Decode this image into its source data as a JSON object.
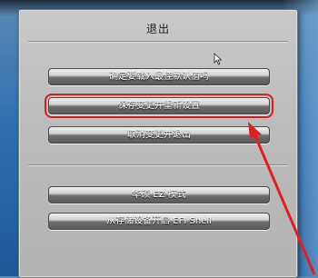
{
  "dialog": {
    "title": "退出",
    "buttons": [
      {
        "label": "确定要载入最佳默认值吗"
      },
      {
        "label": "保存变更并重新设置"
      },
      {
        "label": "取消变更并退出"
      },
      {
        "label": "华硕 EZ 模式"
      },
      {
        "label": "从存储设备开启 EFI Shell"
      }
    ]
  },
  "colors": {
    "highlight": "#d62020",
    "background": "#2f6fae",
    "dialog": "#c0c0c0"
  },
  "icons": {
    "cursor": "mouse-cursor-icon",
    "annotation": "red-arrow-icon"
  }
}
